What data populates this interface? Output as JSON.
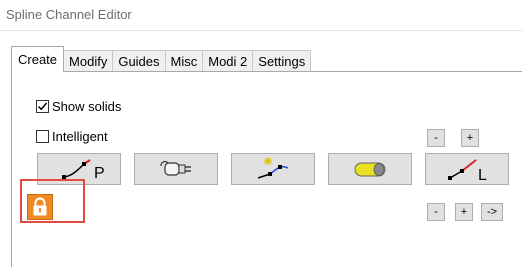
{
  "window": {
    "title": "Spline Channel Editor"
  },
  "tabs": [
    {
      "label": "Create",
      "active": true
    },
    {
      "label": "Modify"
    },
    {
      "label": "Guides"
    },
    {
      "label": "Misc"
    },
    {
      "label": "Modi 2"
    },
    {
      "label": "Settings"
    }
  ],
  "options": {
    "show_solids": {
      "label": "Show solids",
      "checked": true
    },
    "intelligent": {
      "label": "Intelligent",
      "checked": false
    }
  },
  "row1_buttons": {
    "minus": "-",
    "plus": "+"
  },
  "row2_buttons": {
    "minus": "-",
    "plus": "+",
    "arrow": "->"
  },
  "tool_buttons": [
    {
      "icon": "spline-point-icon",
      "letter": "P"
    },
    {
      "icon": "plug-icon"
    },
    {
      "icon": "spline-star-icon"
    },
    {
      "icon": "solid-pill-icon"
    },
    {
      "icon": "spline-line-icon",
      "letter": "L"
    }
  ],
  "lock": {
    "icon": "lock-icon",
    "highlight_color": "#e04a43"
  },
  "colors": {
    "accent_orange": "#f08a24",
    "spline_red": "#e02020",
    "pill_yellow": "#e8e020"
  }
}
